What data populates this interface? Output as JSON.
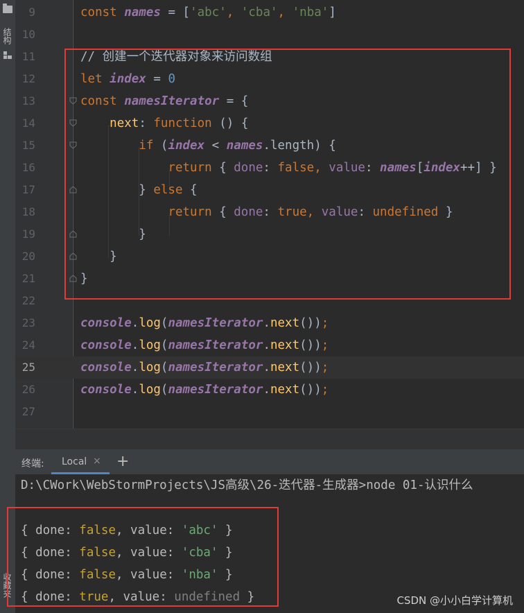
{
  "toolstrip": {
    "structure_label": "结构",
    "bookmarks_label": "收藏夹"
  },
  "editor": {
    "lines": [
      {
        "num": "9"
      },
      {
        "num": "10"
      },
      {
        "num": "11",
        "comment": "// 创建一个迭代器对象来访问数组"
      },
      {
        "num": "12"
      },
      {
        "num": "13"
      },
      {
        "num": "14"
      },
      {
        "num": "15"
      },
      {
        "num": "16"
      },
      {
        "num": "17"
      },
      {
        "num": "18"
      },
      {
        "num": "19"
      },
      {
        "num": "20"
      },
      {
        "num": "21"
      },
      {
        "num": "22"
      },
      {
        "num": "23"
      },
      {
        "num": "24"
      },
      {
        "num": "25"
      },
      {
        "num": "26"
      },
      {
        "num": "27"
      }
    ],
    "current_line": "25"
  },
  "terminal": {
    "title": "终端:",
    "tab_label": "Local",
    "tab_close": "×",
    "add_tab": "+",
    "prompt": "D:\\CWork\\WebStormProjects\\JS高级\\26-迭代器-生成器>node 01-认识什么",
    "output": [
      {
        "done": "false",
        "value": "'abc'"
      },
      {
        "done": "false",
        "value": "'cba'"
      },
      {
        "done": "false",
        "value": "'nba'"
      },
      {
        "done": "true",
        "value": "undefined"
      }
    ]
  },
  "watermark": "CSDN @小小白学计算机"
}
